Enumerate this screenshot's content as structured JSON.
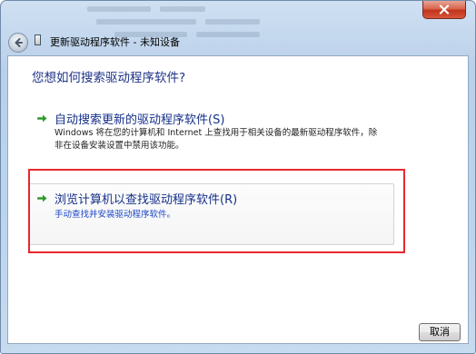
{
  "window": {
    "title": "更新驱动程序软件 - 未知设备",
    "close_icon": "close-icon"
  },
  "content": {
    "heading": "您想如何搜索驱动程序软件?",
    "options": [
      {
        "title": "自动搜索更新的驱动程序软件(S)",
        "description_line1": "Windows 将在您的计算机和 Internet 上查找用于相关设备的最新驱动程序软件，除",
        "description_line2": "非在设备安装设置中禁用该功能。",
        "icon": "green-arrow-icon"
      },
      {
        "title": "浏览计算机以查找驱动程序软件(R)",
        "description_line1": "手动查找并安装驱动程序软件。",
        "icon": "green-arrow-icon",
        "highlighted": true
      }
    ]
  },
  "footer": {
    "cancel_label": "取消"
  },
  "colors": {
    "heading": "#1e3287",
    "option_title": "#15308a",
    "highlight": "#e8282d",
    "arrow": "#2f9a2f"
  }
}
